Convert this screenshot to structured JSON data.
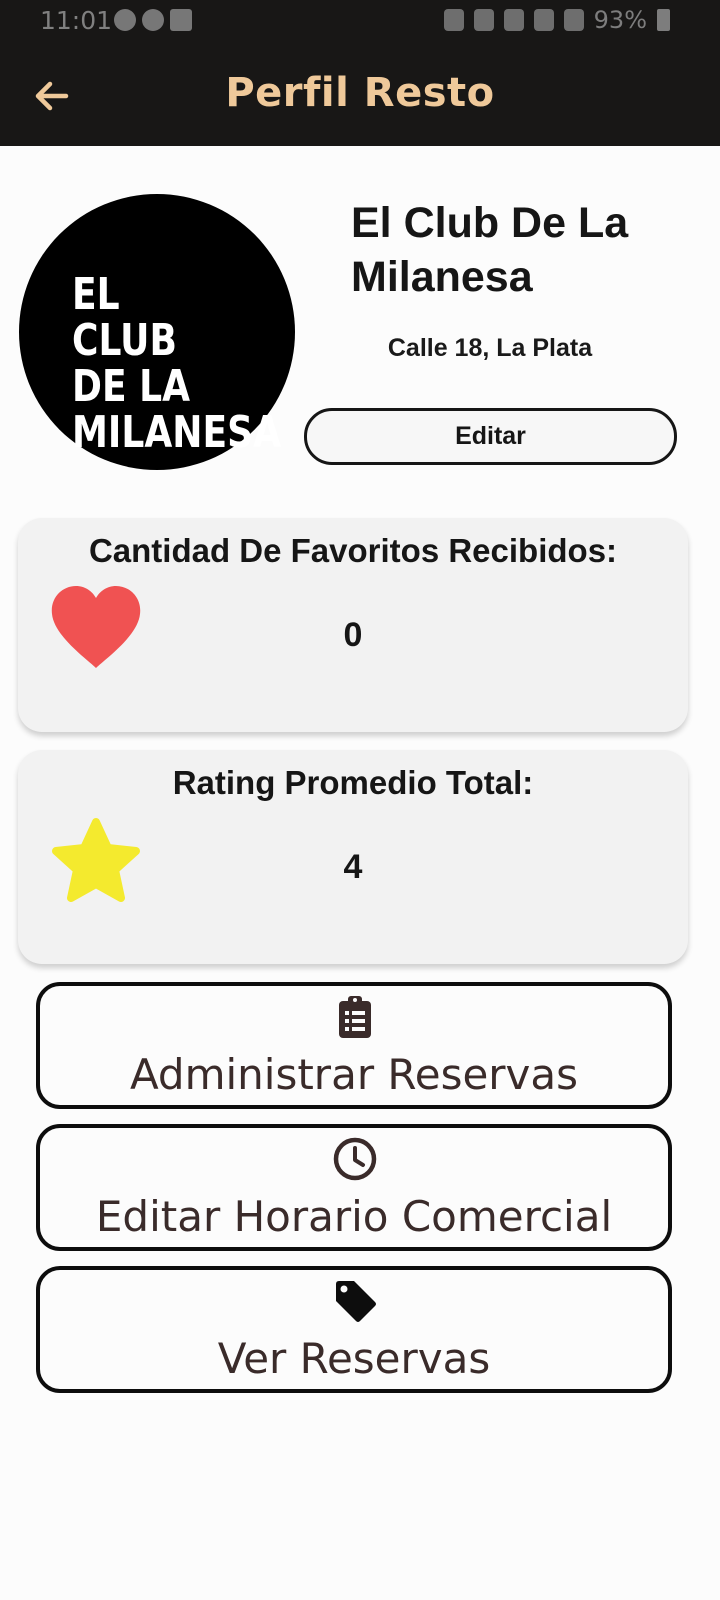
{
  "status_bar": {
    "time": "11:01",
    "battery": "93%"
  },
  "app_bar": {
    "title": "Perfil Resto",
    "back_icon": "arrow-left-icon"
  },
  "profile": {
    "logo_text": "EL CLUB\nDE LA\nMILANESA",
    "name": "El Club De La Milanesa",
    "address": "Calle 18, La Plata",
    "edit_label": "Editar"
  },
  "stats": {
    "favorites": {
      "title": "Cantidad De Favoritos Recibidos:",
      "value": "0",
      "icon": "heart-icon",
      "color": "#f05252"
    },
    "rating": {
      "title": "Rating Promedio Total:",
      "value": "4",
      "icon": "star-icon",
      "color": "#f4ea2e"
    }
  },
  "actions": [
    {
      "label": "Administrar Reservas",
      "icon": "clipboard-list-icon"
    },
    {
      "label": "Editar Horario Comercial",
      "icon": "clock-icon"
    },
    {
      "label": "Ver Reservas",
      "icon": "tag-icon"
    }
  ],
  "colors": {
    "app_bar_bg": "#181716",
    "title_accent": "#efc99a",
    "card_bg": "#f2f2f2",
    "page_bg": "#fcfcfc"
  }
}
